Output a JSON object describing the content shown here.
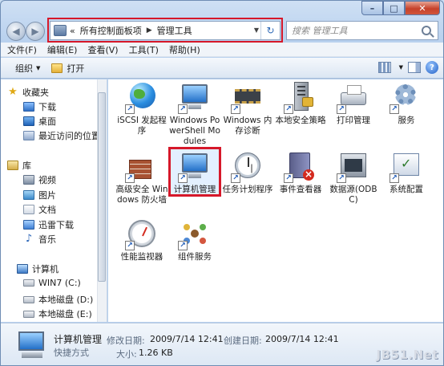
{
  "window": {
    "caption": {
      "minimize": "–",
      "maximize": "□",
      "close": "✕"
    }
  },
  "nav": {
    "back": "◀",
    "forward": "▶"
  },
  "address": {
    "prefix": "«",
    "crumbs": [
      "所有控制面板项",
      "管理工具"
    ],
    "separator": "▶",
    "dropdown": "▼",
    "refresh": "↻"
  },
  "search": {
    "placeholder": "搜索 管理工具"
  },
  "menu": [
    "文件(F)",
    "编辑(E)",
    "查看(V)",
    "工具(T)",
    "帮助(H)"
  ],
  "toolbar": {
    "organize": "组织",
    "caret": "▼",
    "open": "打开",
    "help": "?"
  },
  "sidebar": {
    "favorites": "收藏夹",
    "downloads": "下载",
    "desktop": "桌面",
    "recent": "最近访问的位置",
    "libraries": "库",
    "videos": "视频",
    "pictures": "图片",
    "documents": "文档",
    "thunder": "迅雷下载",
    "music": "音乐",
    "computer": "计算机",
    "drive_c": "WIN7 (C:)",
    "drive_d": "本地磁盘 (D:)",
    "drive_e": "本地磁盘 (E:)"
  },
  "files": [
    {
      "label": "iSCSI 发起程序"
    },
    {
      "label": "Windows PowerShell Modules"
    },
    {
      "label": "Windows 内存诊断"
    },
    {
      "label": "本地安全策略"
    },
    {
      "label": "打印管理"
    },
    {
      "label": "服务"
    },
    {
      "label": "高级安全 Windows 防火墙"
    },
    {
      "label": "计算机管理"
    },
    {
      "label": "任务计划程序"
    },
    {
      "label": "事件查看器"
    },
    {
      "label": "数据源(ODBC)"
    },
    {
      "label": "系统配置"
    },
    {
      "label": "性能监视器"
    },
    {
      "label": "组件服务"
    }
  ],
  "shortcut_glyph": "↗",
  "details": {
    "name": "计算机管理",
    "type": "快捷方式",
    "modified_label": "修改日期:",
    "modified_value": "2009/7/14 12:41",
    "created_label": "创建日期:",
    "created_value": "2009/7/14 12:41",
    "size_label": "大小:",
    "size_value": "1.26 KB"
  },
  "watermark": "JB51.Net"
}
